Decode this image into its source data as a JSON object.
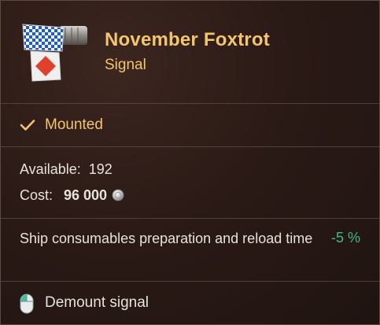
{
  "item": {
    "name": "November Foxtrot",
    "type": "Signal",
    "icon": "signal-flag-icon"
  },
  "status": {
    "label": "Mounted",
    "icon": "check-icon"
  },
  "info": {
    "available_label": "Available:",
    "available_value": "192",
    "cost_label": "Cost:",
    "cost_value": "96 000",
    "currency_icon": "credits-coin-icon"
  },
  "effect": {
    "description": "Ship consumables preparation and reload time",
    "value": "-5 %"
  },
  "action": {
    "label": "Demount signal",
    "icon": "mouse-left-click-icon"
  },
  "colors": {
    "accent": "#f3c56e",
    "positive": "#3fb98a",
    "text": "#e8e2dc",
    "background": "#2b1a16"
  }
}
